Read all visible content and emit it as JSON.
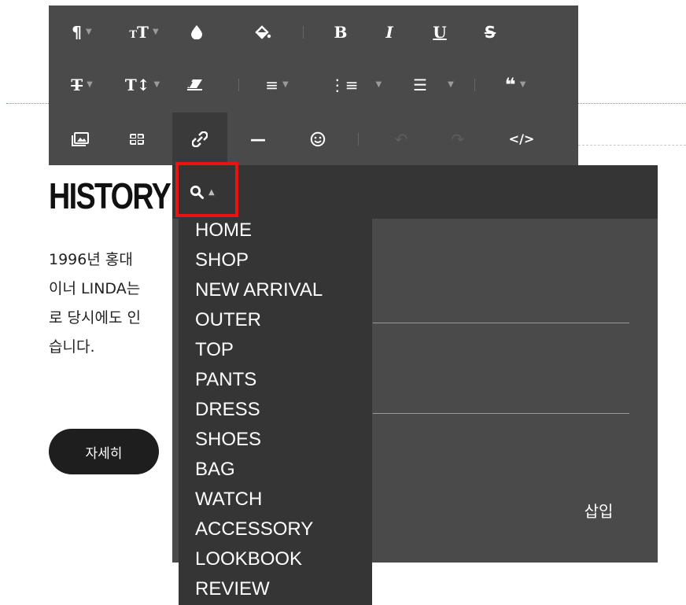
{
  "page": {
    "title": "HISTORY",
    "body_lines": [
      "1996년 홍대",
      "이너 LINDA는",
      "로 당시에도 인",
      "습니다."
    ],
    "more_button": "자세히"
  },
  "toolbar": {
    "rows": [
      [
        {
          "name": "paragraph-style-button",
          "icon": "¶",
          "caret": true
        },
        {
          "name": "font-size-button",
          "icon": "ᴛT",
          "caret": true
        },
        {
          "name": "font-color-button",
          "icon": "💧",
          "caret": false
        },
        {
          "name": "highlight-color-button",
          "icon": "⛾",
          "caret": false
        },
        {
          "name": "bold-button",
          "icon": "B",
          "caret": false
        },
        {
          "name": "italic-button",
          "icon": "I",
          "caret": false
        },
        {
          "name": "underline-button",
          "icon": "U",
          "caret": false
        },
        {
          "name": "strikethrough-button",
          "icon": "S",
          "caret": false
        }
      ],
      [
        {
          "name": "text-format-button",
          "icon": "Ŧ",
          "caret": true
        },
        {
          "name": "line-height-button",
          "icon": "T↕",
          "caret": true
        },
        {
          "name": "clear-format-button",
          "icon": "⌫",
          "caret": false
        },
        {
          "name": "align-button",
          "icon": "≡",
          "caret": true
        },
        {
          "name": "ordered-list-button",
          "icon": "⒈",
          "caret": true
        },
        {
          "name": "bullet-list-button",
          "icon": "☰",
          "caret": true
        },
        {
          "name": "quote-button",
          "icon": "❝",
          "caret": true
        }
      ],
      [
        {
          "name": "image-button",
          "icon": "▣",
          "caret": false
        },
        {
          "name": "table-button",
          "icon": "⊞",
          "caret": false
        },
        {
          "name": "link-button",
          "icon": "∞",
          "caret": false
        },
        {
          "name": "horizontal-rule-button",
          "icon": "—",
          "caret": false
        },
        {
          "name": "emoji-button",
          "icon": "☺",
          "caret": false
        },
        {
          "name": "undo-button",
          "icon": "↶",
          "caret": false
        },
        {
          "name": "redo-button",
          "icon": "↷",
          "caret": false
        },
        {
          "name": "html-source-button",
          "icon": "</>",
          "caret": false
        }
      ]
    ]
  },
  "link_dialog": {
    "search_icon": "search-icon",
    "insert_label": "삽입",
    "menu_items": [
      "HOME",
      "SHOP",
      "NEW ARRIVAL",
      "OUTER",
      "TOP",
      "PANTS",
      "DRESS",
      "SHOES",
      "BAG",
      "WATCH",
      "ACCESSORY",
      "LOOKBOOK",
      "REVIEW"
    ]
  },
  "colors": {
    "toolbar_bg": "#4a4a4a",
    "dropdown_bg": "#353535",
    "highlight_red": "#ee1111",
    "button_dark": "#1e1e1e"
  }
}
